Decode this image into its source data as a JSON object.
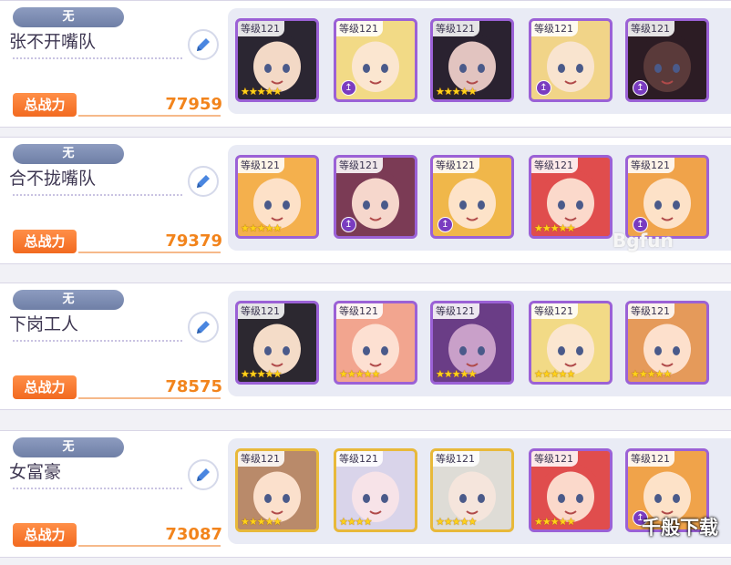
{
  "teams": [
    {
      "tag": "无",
      "name": "张不开嘴队",
      "power_label": "总战力",
      "power": "77959",
      "cards": [
        {
          "level": "等级121",
          "stars": "★★★★★",
          "frame": "purple",
          "colors": [
            "#2b2632",
            "#f3d9c6"
          ]
        },
        {
          "level": "等级121",
          "stars": "",
          "frame": "purple",
          "colors": [
            "#f2da86",
            "#fbe6d0"
          ]
        },
        {
          "level": "等级121",
          "stars": "★★★★★",
          "frame": "purple",
          "colors": [
            "#2a2230",
            "#e2c4c0"
          ]
        },
        {
          "level": "等级121",
          "stars": "",
          "frame": "purple",
          "colors": [
            "#f1d488",
            "#f9e4cf"
          ]
        },
        {
          "level": "等级121",
          "stars": "",
          "frame": "purple",
          "colors": [
            "#2c1c24",
            "#5a3a3a"
          ]
        }
      ]
    },
    {
      "tag": "无",
      "name": "合不拢嘴队",
      "power_label": "总战力",
      "power": "79379",
      "cards": [
        {
          "level": "等级121",
          "stars": "★★★★★",
          "frame": "purple",
          "colors": [
            "#f4b04d",
            "#fde1c8"
          ]
        },
        {
          "level": "等级121",
          "stars": "",
          "frame": "purple",
          "colors": [
            "#7b3b55",
            "#f6d7cc"
          ]
        },
        {
          "level": "等级121",
          "stars": "",
          "frame": "purple",
          "colors": [
            "#f0b74a",
            "#fde3c9"
          ]
        },
        {
          "level": "等级121",
          "stars": "★★★★★",
          "frame": "purple",
          "colors": [
            "#e04d4d",
            "#fbd9cb"
          ]
        },
        {
          "level": "等级121",
          "stars": "",
          "frame": "purple",
          "colors": [
            "#f0a34a",
            "#fde2c8"
          ]
        }
      ]
    },
    {
      "tag": "无",
      "name": "下岗工人",
      "power_label": "总战力",
      "power": "78575",
      "cards": [
        {
          "level": "等级121",
          "stars": "★★★★★",
          "frame": "purple",
          "colors": [
            "#2c2830",
            "#f4dcc8"
          ]
        },
        {
          "level": "等级121",
          "stars": "★★★★★",
          "frame": "purple",
          "colors": [
            "#f2a58f",
            "#fde0d2"
          ]
        },
        {
          "level": "等级121",
          "stars": "★★★★★",
          "frame": "purple",
          "colors": [
            "#6a3d86",
            "#c9a0c9"
          ]
        },
        {
          "level": "等级121",
          "stars": "★★★★★",
          "frame": "purple",
          "colors": [
            "#f2da86",
            "#fbe6d0"
          ]
        },
        {
          "level": "等级121",
          "stars": "★★★★★",
          "frame": "purple",
          "colors": [
            "#e59a5a",
            "#fde0cc"
          ]
        }
      ]
    },
    {
      "tag": "无",
      "name": "女富豪",
      "power_label": "总战力",
      "power": "73087",
      "cards": [
        {
          "level": "等级121",
          "stars": "★★★★★",
          "frame": "gold",
          "colors": [
            "#b98a6a",
            "#fbe0cc"
          ]
        },
        {
          "level": "等级121",
          "stars": "★★★★",
          "frame": "gold",
          "colors": [
            "#d9d4ea",
            "#f7e3e8"
          ]
        },
        {
          "level": "等级121",
          "stars": "★★★★★",
          "frame": "gold",
          "colors": [
            "#dedcd6",
            "#f5e5dc"
          ]
        },
        {
          "level": "等级121",
          "stars": "★★★★★",
          "frame": "purple",
          "colors": [
            "#e04d4d",
            "#fbd9cb"
          ]
        },
        {
          "level": "等级121",
          "stars": "",
          "frame": "purple",
          "colors": [
            "#f0a34a",
            "#fde2c8"
          ]
        }
      ]
    }
  ],
  "watermark_top": "Bgfun",
  "watermark_bottom": "千般下载",
  "icon_edit": "pencil-icon",
  "icon_ue": "unique-equipment-icon"
}
